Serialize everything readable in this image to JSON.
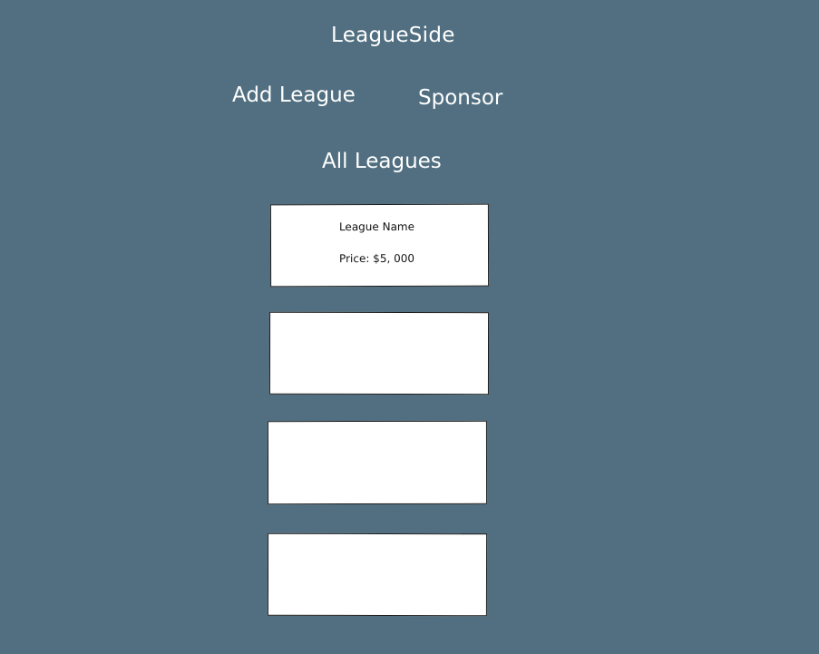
{
  "header": {
    "app_title": "LeagueSide"
  },
  "nav": {
    "add_league": "Add League",
    "sponsor": "Sponsor"
  },
  "section": {
    "title": "All Leagues"
  },
  "leagues": [
    {
      "name": "League Name",
      "price": "Price: $5, 000"
    },
    {
      "name": "",
      "price": ""
    },
    {
      "name": "",
      "price": ""
    },
    {
      "name": "",
      "price": ""
    }
  ],
  "colors": {
    "background": "#516f80",
    "text": "#ffffff",
    "card_background": "#ffffff",
    "card_border": "#1a1a1a"
  }
}
